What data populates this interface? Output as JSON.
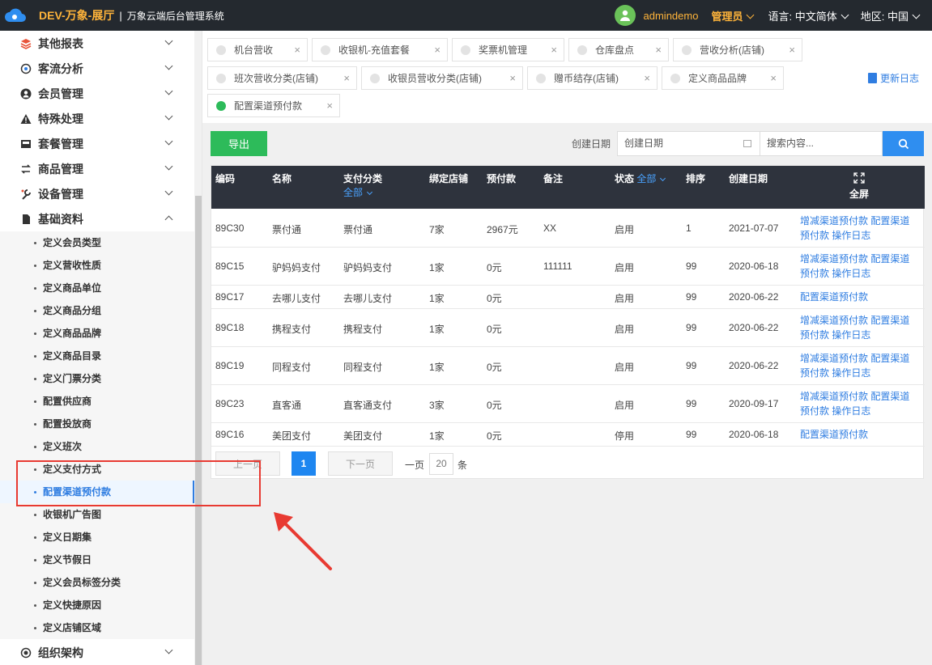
{
  "header": {
    "brand": "DEV-万象-展厅",
    "separator": "|",
    "system_name": "万象云端后台管理系统",
    "user": "admindemo",
    "role": "管理员",
    "language_label": "语言:",
    "language_value": "中文简体",
    "region_label": "地区:",
    "region_value": "中国"
  },
  "sidebar": {
    "top_items": [
      {
        "label": "其他报表",
        "icon": "layers-icon"
      },
      {
        "label": "客流分析",
        "icon": "target-icon"
      },
      {
        "label": "会员管理",
        "icon": "user-icon"
      },
      {
        "label": "特殊处理",
        "icon": "warning-icon"
      },
      {
        "label": "套餐管理",
        "icon": "inbox-icon"
      },
      {
        "label": "商品管理",
        "icon": "swap-icon"
      },
      {
        "label": "设备管理",
        "icon": "wrench-icon"
      },
      {
        "label": "基础资料",
        "icon": "file-icon"
      }
    ],
    "sub_items": [
      "定义会员类型",
      "定义营收性质",
      "定义商品单位",
      "定义商品分组",
      "定义商品品牌",
      "定义商品目录",
      "定义门票分类",
      "配置供应商",
      "配置投放商",
      "定义班次",
      "定义支付方式",
      "配置渠道预付款",
      "收银机广告图",
      "定义日期集",
      "定义节假日",
      "定义会员标签分类",
      "定义快捷原因",
      "定义店铺区域"
    ],
    "bottom_item": {
      "label": "组织架构",
      "icon": "org-icon"
    }
  },
  "tabs": [
    {
      "label": "机台营收",
      "active": false
    },
    {
      "label": "收银机-充值套餐",
      "active": false
    },
    {
      "label": "奖票机管理",
      "active": false
    },
    {
      "label": "仓库盘点",
      "active": false
    },
    {
      "label": "营收分析(店铺)",
      "active": false
    },
    {
      "label": "班次营收分类(店铺)",
      "active": false
    },
    {
      "label": "收银员营收分类(店铺)",
      "active": false
    },
    {
      "label": "赠币结存(店铺)",
      "active": false
    },
    {
      "label": "定义商品品牌",
      "active": false
    },
    {
      "label": "配置渠道预付款",
      "active": true
    }
  ],
  "tab_close": "×",
  "update_log": "更新日志",
  "toolbar": {
    "export": "导出",
    "date_label": "创建日期",
    "date_placeholder": "创建日期",
    "search_placeholder": "搜索内容..."
  },
  "table": {
    "headers": {
      "code": "编码",
      "name": "名称",
      "pay_type": "支付分类",
      "pay_type_filter": "全部",
      "stores": "绑定店铺",
      "prepay": "预付款",
      "remark": "备注",
      "status": "状态",
      "status_filter": "全部",
      "sort": "排序",
      "created": "创建日期",
      "fullscreen": "全屏"
    },
    "rows": [
      {
        "code": "89C30",
        "name": "票付通",
        "pay_type": "票付通",
        "stores": "7家",
        "prepay": "2967元",
        "remark": "XX",
        "status": "启用",
        "sort": "1",
        "created": "2021-07-07",
        "a1": "增减渠道预付款 配置渠道",
        "a2": "预付款 操作日志"
      },
      {
        "code": "89C15",
        "name": "驴妈妈支付",
        "pay_type": "驴妈妈支付",
        "stores": "1家",
        "prepay": "0元",
        "remark": "111111",
        "status": "启用",
        "sort": "99",
        "created": "2020-06-18",
        "a1": "增减渠道预付款 配置渠道",
        "a2": "预付款 操作日志"
      },
      {
        "code": "89C17",
        "name": "去哪儿支付",
        "pay_type": "去哪儿支付",
        "stores": "1家",
        "prepay": "0元",
        "remark": "",
        "status": "启用",
        "sort": "99",
        "created": "2020-06-22",
        "a1": "配置渠道预付款",
        "a2": ""
      },
      {
        "code": "89C18",
        "name": "携程支付",
        "pay_type": "携程支付",
        "stores": "1家",
        "prepay": "0元",
        "remark": "",
        "status": "启用",
        "sort": "99",
        "created": "2020-06-22",
        "a1": "增减渠道预付款 配置渠道",
        "a2": "预付款 操作日志"
      },
      {
        "code": "89C19",
        "name": "同程支付",
        "pay_type": "同程支付",
        "stores": "1家",
        "prepay": "0元",
        "remark": "",
        "status": "启用",
        "sort": "99",
        "created": "2020-06-22",
        "a1": "增减渠道预付款 配置渠道",
        "a2": "预付款 操作日志"
      },
      {
        "code": "89C23",
        "name": "直客通",
        "pay_type": "直客通支付",
        "stores": "3家",
        "prepay": "0元",
        "remark": "",
        "status": "启用",
        "sort": "99",
        "created": "2020-09-17",
        "a1": "增减渠道预付款 配置渠道",
        "a2": "预付款 操作日志"
      },
      {
        "code": "89C16",
        "name": "美团支付",
        "pay_type": "美团支付",
        "stores": "1家",
        "prepay": "0元",
        "remark": "",
        "status": "停用",
        "sort": "99",
        "created": "2020-06-18",
        "a1": "配置渠道预付款",
        "a2": ""
      }
    ]
  },
  "pager": {
    "prev": "上一页",
    "current": "1",
    "next": "下一页",
    "per_page_label": "一页",
    "per_page": "20",
    "unit": "条"
  },
  "colors": {
    "accent": "#2f7de1",
    "export": "#2dbb5a",
    "header_bg": "#24292f",
    "brand": "#ffb43a",
    "highlight": "#e83a32"
  }
}
